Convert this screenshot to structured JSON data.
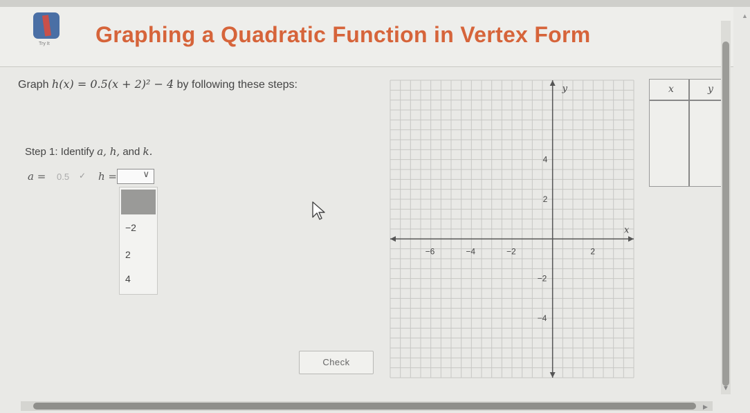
{
  "header": {
    "title": "Graphing a Quadratic Function in Vertex Form",
    "logo_caption": "Try It"
  },
  "prompt": {
    "prefix": "Graph ",
    "function": "h(x) = 0.5(x + 2)² − 4",
    "suffix": " by following these steps:"
  },
  "step1": {
    "label": "Step 1: Identify ",
    "vars": "a, h,",
    "and": " and ",
    "k": "k."
  },
  "inputs": {
    "a_label": "a =",
    "a_value": "0.5",
    "h_label": "h =",
    "h_value": ""
  },
  "dropdown": {
    "options": [
      "−2",
      "2",
      "4"
    ]
  },
  "check_button": {
    "label": "Check"
  },
  "graph": {
    "x_axis_label": "x",
    "y_axis_label": "y",
    "x_ticks": [
      "−6",
      "−4",
      "−2",
      "2"
    ],
    "y_ticks": [
      "4",
      "2",
      "−2",
      "−4"
    ],
    "x_range": [
      -8,
      4
    ],
    "y_range": [
      -7,
      8
    ]
  },
  "table": {
    "col_x": "x",
    "col_y": "y"
  },
  "colors": {
    "title": "#d6643a",
    "logo": "#4a6fa5"
  },
  "icons": {
    "cursor": "mouse-pointer-icon",
    "chevron": "chevron-down-icon"
  }
}
